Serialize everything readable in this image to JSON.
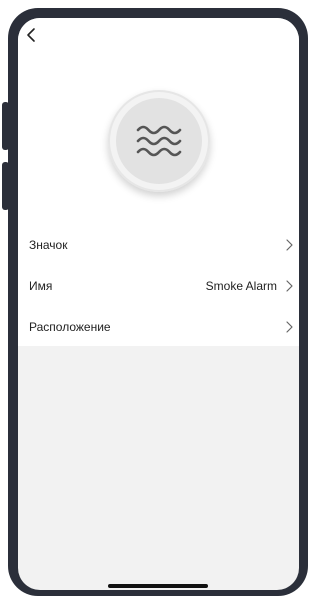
{
  "header": {
    "back_icon": "chevron-left-icon"
  },
  "device": {
    "icon": "waves-icon"
  },
  "settings": [
    {
      "label": "Значок",
      "value": "",
      "chevron": "chevron-right-icon"
    },
    {
      "label": "Имя",
      "value": "Smoke Alarm",
      "chevron": "chevron-right-icon"
    },
    {
      "label": "Расположение",
      "value": "",
      "chevron": "chevron-right-icon"
    }
  ],
  "colors": {
    "frame": "#2b2f3a",
    "background": "#f2f2f2",
    "text": "#222222"
  }
}
